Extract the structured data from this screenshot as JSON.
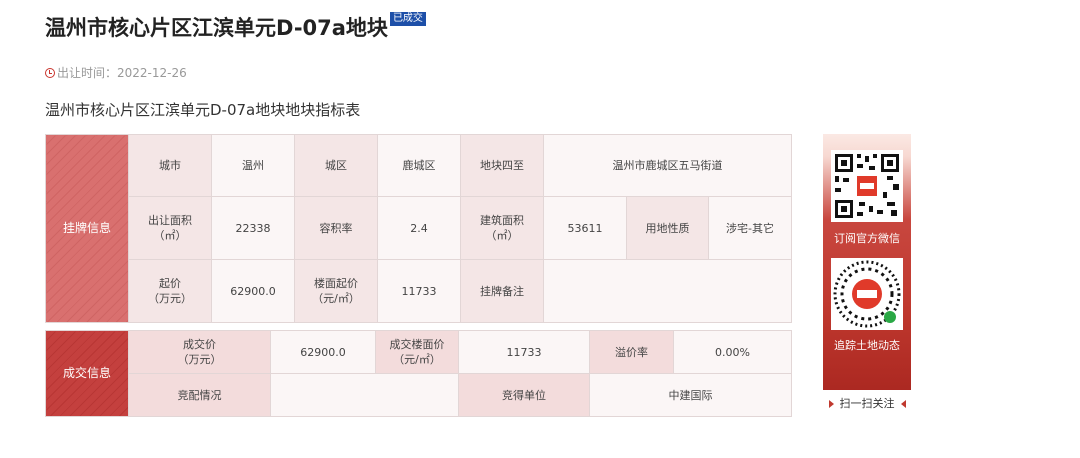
{
  "header": {
    "title": "温州市核心片区江滨单元D-07a地块",
    "badge": "已成交",
    "time_label": "出让时间：",
    "time_value": "2022-12-26",
    "subtitle": "温州市核心片区江滨单元D-07a地块地块指标表"
  },
  "listing": {
    "section_label": "挂牌信息",
    "city_label": "城市",
    "city_value": "温州",
    "district_label": "城区",
    "district_value": "鹿城区",
    "boundary_label": "地块四至",
    "boundary_value": "温州市鹿城区五马街道",
    "area_label": "出让面积\n（㎡）",
    "area_value": "22338",
    "far_label": "容积率",
    "far_value": "2.4",
    "build_area_label": "建筑面积\n（㎡）",
    "build_area_value": "53611",
    "use_label": "用地性质",
    "use_value": "涉宅-其它",
    "start_price_label": "起价\n（万元）",
    "start_price_value": "62900.0",
    "floor_price_label": "楼面起价\n（元/㎡）",
    "floor_price_value": "11733",
    "note_label": "挂牌备注",
    "note_value": ""
  },
  "deal": {
    "section_label": "成交信息",
    "price_label": "成交价\n（万元）",
    "price_value": "62900.0",
    "floor_price_label": "成交楼面价\n（元/㎡）",
    "floor_price_value": "11733",
    "premium_label": "溢价率",
    "premium_value": "0.00%",
    "bid_label": "竞配情况",
    "bid_value": "",
    "winner_label": "竞得单位",
    "winner_value": "中建国际"
  },
  "sidebar": {
    "qr1_caption": "订阅官方微信",
    "qr2_caption": "追踪土地动态",
    "follow_text": "扫一扫关注"
  }
}
